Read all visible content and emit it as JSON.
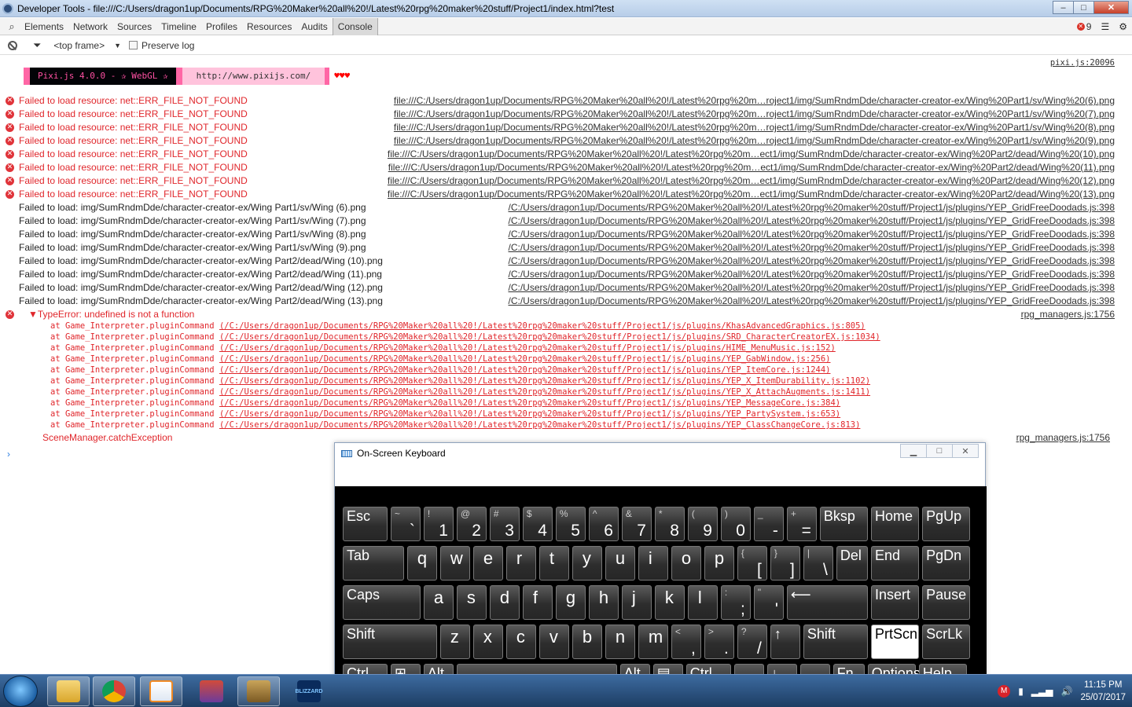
{
  "window": {
    "title": "Developer Tools - file:///C:/Users/dragon1up/Documents/RPG%20Maker%20all%20!/Latest%20rpg%20maker%20stuff/Project1/index.html?test",
    "minimize": "–",
    "maximize": "□",
    "close": "✕"
  },
  "toolbar": {
    "tabs": [
      "Elements",
      "Network",
      "Sources",
      "Timeline",
      "Profiles",
      "Resources",
      "Audits",
      "Console"
    ],
    "error_count": "9"
  },
  "filter": {
    "frame": "<top frame>",
    "preserve_log": "Preserve log"
  },
  "pixi": {
    "banner": "Pixi.js 4.0.0 - ✰ WebGL ✰",
    "url": "http://www.pixijs.com/",
    "hearts": "♥♥♥",
    "source": "pixi.js:20096"
  },
  "resource_errors": [
    {
      "msg": "Failed to load resource: net::ERR_FILE_NOT_FOUND",
      "src": "file:///C:/Users/dragon1up/Documents/RPG%20Maker%20all%20!/Latest%20rpg%20m…roject1/img/SumRndmDde/character-creator-ex/Wing%20Part1/sv/Wing%20(6).png"
    },
    {
      "msg": "Failed to load resource: net::ERR_FILE_NOT_FOUND",
      "src": "file:///C:/Users/dragon1up/Documents/RPG%20Maker%20all%20!/Latest%20rpg%20m…roject1/img/SumRndmDde/character-creator-ex/Wing%20Part1/sv/Wing%20(7).png"
    },
    {
      "msg": "Failed to load resource: net::ERR_FILE_NOT_FOUND",
      "src": "file:///C:/Users/dragon1up/Documents/RPG%20Maker%20all%20!/Latest%20rpg%20m…roject1/img/SumRndmDde/character-creator-ex/Wing%20Part1/sv/Wing%20(8).png"
    },
    {
      "msg": "Failed to load resource: net::ERR_FILE_NOT_FOUND",
      "src": "file:///C:/Users/dragon1up/Documents/RPG%20Maker%20all%20!/Latest%20rpg%20m…roject1/img/SumRndmDde/character-creator-ex/Wing%20Part1/sv/Wing%20(9).png"
    },
    {
      "msg": "Failed to load resource: net::ERR_FILE_NOT_FOUND",
      "src": "file:///C:/Users/dragon1up/Documents/RPG%20Maker%20all%20!/Latest%20rpg%20m…ect1/img/SumRndmDde/character-creator-ex/Wing%20Part2/dead/Wing%20(10).png"
    },
    {
      "msg": "Failed to load resource: net::ERR_FILE_NOT_FOUND",
      "src": "file:///C:/Users/dragon1up/Documents/RPG%20Maker%20all%20!/Latest%20rpg%20m…ect1/img/SumRndmDde/character-creator-ex/Wing%20Part2/dead/Wing%20(11).png"
    },
    {
      "msg": "Failed to load resource: net::ERR_FILE_NOT_FOUND",
      "src": "file:///C:/Users/dragon1up/Documents/RPG%20Maker%20all%20!/Latest%20rpg%20m…ect1/img/SumRndmDde/character-creator-ex/Wing%20Part2/dead/Wing%20(12).png"
    },
    {
      "msg": "Failed to load resource: net::ERR_FILE_NOT_FOUND",
      "src": "file:///C:/Users/dragon1up/Documents/RPG%20Maker%20all%20!/Latest%20rpg%20m…ect1/img/SumRndmDde/character-creator-ex/Wing%20Part2/dead/Wing%20(13).png"
    }
  ],
  "load_failures": [
    {
      "msg": "Failed to load: img/SumRndmDde/character-creator-ex/Wing Part1/sv/Wing (6).png",
      "src": "/C:/Users/dragon1up/Documents/RPG%20Maker%20all%20!/Latest%20rpg%20maker%20stuff/Project1/js/plugins/YEP_GridFreeDoodads.js:398"
    },
    {
      "msg": "Failed to load: img/SumRndmDde/character-creator-ex/Wing Part1/sv/Wing (7).png",
      "src": "/C:/Users/dragon1up/Documents/RPG%20Maker%20all%20!/Latest%20rpg%20maker%20stuff/Project1/js/plugins/YEP_GridFreeDoodads.js:398"
    },
    {
      "msg": "Failed to load: img/SumRndmDde/character-creator-ex/Wing Part1/sv/Wing (8).png",
      "src": "/C:/Users/dragon1up/Documents/RPG%20Maker%20all%20!/Latest%20rpg%20maker%20stuff/Project1/js/plugins/YEP_GridFreeDoodads.js:398"
    },
    {
      "msg": "Failed to load: img/SumRndmDde/character-creator-ex/Wing Part1/sv/Wing (9).png",
      "src": "/C:/Users/dragon1up/Documents/RPG%20Maker%20all%20!/Latest%20rpg%20maker%20stuff/Project1/js/plugins/YEP_GridFreeDoodads.js:398"
    },
    {
      "msg": "Failed to load: img/SumRndmDde/character-creator-ex/Wing Part2/dead/Wing (10).png",
      "src": "/C:/Users/dragon1up/Documents/RPG%20Maker%20all%20!/Latest%20rpg%20maker%20stuff/Project1/js/plugins/YEP_GridFreeDoodads.js:398"
    },
    {
      "msg": "Failed to load: img/SumRndmDde/character-creator-ex/Wing Part2/dead/Wing (11).png",
      "src": "/C:/Users/dragon1up/Documents/RPG%20Maker%20all%20!/Latest%20rpg%20maker%20stuff/Project1/js/plugins/YEP_GridFreeDoodads.js:398"
    },
    {
      "msg": "Failed to load: img/SumRndmDde/character-creator-ex/Wing Part2/dead/Wing (12).png",
      "src": "/C:/Users/dragon1up/Documents/RPG%20Maker%20all%20!/Latest%20rpg%20maker%20stuff/Project1/js/plugins/YEP_GridFreeDoodads.js:398"
    },
    {
      "msg": "Failed to load: img/SumRndmDde/character-creator-ex/Wing Part2/dead/Wing (13).png",
      "src": "/C:/Users/dragon1up/Documents/RPG%20Maker%20all%20!/Latest%20rpg%20maker%20stuff/Project1/js/plugins/YEP_GridFreeDoodads.js:398"
    }
  ],
  "type_error": {
    "msg": "▼TypeError: undefined is not a function",
    "src": "rpg_managers.js:1756",
    "stack": [
      {
        "at": "at Game_Interpreter.pluginCommand ",
        "link": "(/C:/Users/dragon1up/Documents/RPG%20Maker%20all%20!/Latest%20rpg%20maker%20stuff/Project1/js/plugins/KhasAdvancedGraphics.js:805)"
      },
      {
        "at": "at Game_Interpreter.pluginCommand ",
        "link": "(/C:/Users/dragon1up/Documents/RPG%20Maker%20all%20!/Latest%20rpg%20maker%20stuff/Project1/js/plugins/SRD_CharacterCreatorEX.js:1034)"
      },
      {
        "at": "at Game_Interpreter.pluginCommand ",
        "link": "(/C:/Users/dragon1up/Documents/RPG%20Maker%20all%20!/Latest%20rpg%20maker%20stuff/Project1/js/plugins/HIME_MenuMusic.js:152)"
      },
      {
        "at": "at Game_Interpreter.pluginCommand ",
        "link": "(/C:/Users/dragon1up/Documents/RPG%20Maker%20all%20!/Latest%20rpg%20maker%20stuff/Project1/js/plugins/YEP_GabWindow.js:256)"
      },
      {
        "at": "at Game_Interpreter.pluginCommand ",
        "link": "(/C:/Users/dragon1up/Documents/RPG%20Maker%20all%20!/Latest%20rpg%20maker%20stuff/Project1/js/plugins/YEP_ItemCore.js:1244)"
      },
      {
        "at": "at Game_Interpreter.pluginCommand ",
        "link": "(/C:/Users/dragon1up/Documents/RPG%20Maker%20all%20!/Latest%20rpg%20maker%20stuff/Project1/js/plugins/YEP_X_ItemDurability.js:1102)"
      },
      {
        "at": "at Game_Interpreter.pluginCommand ",
        "link": "(/C:/Users/dragon1up/Documents/RPG%20Maker%20all%20!/Latest%20rpg%20maker%20stuff/Project1/js/plugins/YEP_X_AttachAugments.js:1411)"
      },
      {
        "at": "at Game_Interpreter.pluginCommand ",
        "link": "(/C:/Users/dragon1up/Documents/RPG%20Maker%20all%20!/Latest%20rpg%20maker%20stuff/Project1/js/plugins/YEP_MessageCore.js:384)"
      },
      {
        "at": "at Game_Interpreter.pluginCommand ",
        "link": "(/C:/Users/dragon1up/Documents/RPG%20Maker%20all%20!/Latest%20rpg%20maker%20stuff/Project1/js/plugins/YEP_PartySystem.js:653)"
      },
      {
        "at": "at Game_Interpreter.pluginCommand ",
        "link": "(/C:/Users/dragon1up/Documents/RPG%20Maker%20all%20!/Latest%20rpg%20maker%20stuff/Project1/js/plugins/YEP_ClassChangeCore.js:813)"
      }
    ],
    "catch": "SceneManager.catchException",
    "catch_src": "rpg_managers.js:1756"
  },
  "prompt": "›",
  "osk": {
    "title": "On-Screen Keyboard",
    "rows": [
      [
        [
          "Esc",
          ""
        ],
        [
          "~",
          "`"
        ],
        [
          "!",
          "1"
        ],
        [
          "@",
          "2"
        ],
        [
          "#",
          "3"
        ],
        [
          "$",
          "4"
        ],
        [
          "%",
          "5"
        ],
        [
          "^",
          "6"
        ],
        [
          "&",
          "7"
        ],
        [
          "*",
          "8"
        ],
        [
          "(",
          "9"
        ],
        [
          ")",
          "0"
        ],
        [
          "_",
          "-"
        ],
        [
          "+",
          "="
        ],
        [
          "Bksp",
          ""
        ],
        [
          "Home",
          ""
        ],
        [
          "PgUp",
          ""
        ]
      ],
      [
        [
          "Tab",
          ""
        ],
        [
          "",
          "q"
        ],
        [
          "",
          "w"
        ],
        [
          "",
          "e"
        ],
        [
          "",
          "r"
        ],
        [
          "",
          "t"
        ],
        [
          "",
          "y"
        ],
        [
          "",
          "u"
        ],
        [
          "",
          "i"
        ],
        [
          "",
          "o"
        ],
        [
          "",
          "p"
        ],
        [
          "{",
          "["
        ],
        [
          "}",
          "]"
        ],
        [
          "|",
          "\\"
        ],
        [
          "Del",
          ""
        ],
        [
          "End",
          ""
        ],
        [
          "PgDn",
          ""
        ]
      ],
      [
        [
          "Caps",
          ""
        ],
        [
          "",
          "a"
        ],
        [
          "",
          "s"
        ],
        [
          "",
          "d"
        ],
        [
          "",
          "f"
        ],
        [
          "",
          "g"
        ],
        [
          "",
          "h"
        ],
        [
          "",
          "j"
        ],
        [
          "",
          "k"
        ],
        [
          "",
          "l"
        ],
        [
          ":",
          ";"
        ],
        [
          "\"",
          "'"
        ],
        [
          "⟵",
          ""
        ],
        [
          "Insert",
          ""
        ],
        [
          "Pause",
          ""
        ]
      ],
      [
        [
          "Shift",
          ""
        ],
        [
          "",
          "z"
        ],
        [
          "",
          "x"
        ],
        [
          "",
          "c"
        ],
        [
          "",
          "v"
        ],
        [
          "",
          "b"
        ],
        [
          "",
          "n"
        ],
        [
          "",
          "m"
        ],
        [
          "<",
          ","
        ],
        [
          ">",
          "."
        ],
        [
          "?",
          "/"
        ],
        [
          "↑",
          ""
        ],
        [
          "Shift",
          ""
        ],
        [
          "PrtScn",
          ""
        ],
        [
          "ScrLk",
          ""
        ]
      ],
      [
        [
          "Ctrl",
          ""
        ],
        [
          "⊞",
          ""
        ],
        [
          "Alt",
          ""
        ],
        [
          "",
          ""
        ],
        [
          "Alt",
          ""
        ],
        [
          "▤",
          ""
        ],
        [
          "Ctrl",
          ""
        ],
        [
          "←",
          ""
        ],
        [
          "↓",
          ""
        ],
        [
          "→",
          ""
        ],
        [
          "Fn",
          ""
        ],
        [
          "Options",
          ""
        ],
        [
          "Help",
          ""
        ]
      ]
    ]
  },
  "taskbar": {
    "time": "11:15 PM",
    "date": "25/07/2017",
    "apps": [
      "file-explorer",
      "chrome",
      "media-player",
      "rpg-maker",
      "script-editor",
      "blizzard"
    ],
    "blizzard_label": "BLIZZARD"
  }
}
